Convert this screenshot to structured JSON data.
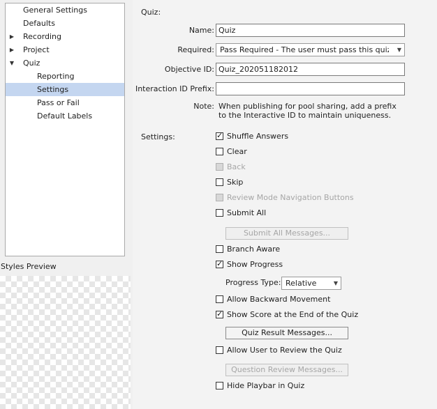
{
  "tree": {
    "items": [
      {
        "label": "General Settings",
        "expander": ""
      },
      {
        "label": "Defaults",
        "expander": ""
      },
      {
        "label": "Recording",
        "expander": "▶"
      },
      {
        "label": "Project",
        "expander": "▶"
      },
      {
        "label": "Quiz",
        "expander": "▼"
      },
      {
        "label": "Reporting",
        "expander": ""
      },
      {
        "label": "Settings",
        "expander": "",
        "selected": true
      },
      {
        "label": "Pass or Fail",
        "expander": ""
      },
      {
        "label": "Default Labels",
        "expander": ""
      }
    ]
  },
  "styles_preview": {
    "label": "Styles Preview"
  },
  "quiz": {
    "section_label": "Quiz:",
    "name_label": "Name:",
    "name_value": "Quiz",
    "required_label": "Required:",
    "required_value": "Pass Required - The user must pass this quiz...",
    "objective_label": "Objective ID:",
    "objective_value": "Quiz_202051182012",
    "interaction_label": "Interaction ID Prefix:",
    "interaction_value": "",
    "note_label": "Note:",
    "note_line1": "When publishing for pool sharing, add a prefix",
    "note_line2": "to the Interactive ID to maintain uniqueness."
  },
  "settings": {
    "label": "Settings:",
    "shuffle_answers": {
      "label": "Shuffle Answers",
      "checked": true
    },
    "clear": {
      "label": "Clear",
      "checked": false
    },
    "back": {
      "label": "Back",
      "checked": false,
      "disabled": true
    },
    "skip": {
      "label": "Skip",
      "checked": false
    },
    "review_mode": {
      "label": "Review Mode Navigation Buttons",
      "checked": false,
      "disabled": true
    },
    "submit_all": {
      "label": "Submit All",
      "checked": false
    },
    "submit_all_messages_button": "Submit All Messages...",
    "branch_aware": {
      "label": "Branch Aware",
      "checked": false
    },
    "show_progress": {
      "label": "Show Progress",
      "checked": true
    },
    "progress_type_label": "Progress Type:",
    "progress_type_value": "Relative",
    "allow_backward": {
      "label": "Allow Backward Movement",
      "checked": false
    },
    "show_score": {
      "label": "Show Score at the End of the Quiz",
      "checked": true
    },
    "quiz_result_messages_button": "Quiz Result Messages...",
    "allow_review": {
      "label": "Allow User to Review the Quiz",
      "checked": false
    },
    "question_review_messages_button": "Question Review Messages...",
    "hide_playbar": {
      "label": "Hide Playbar in Quiz",
      "checked": false
    }
  }
}
